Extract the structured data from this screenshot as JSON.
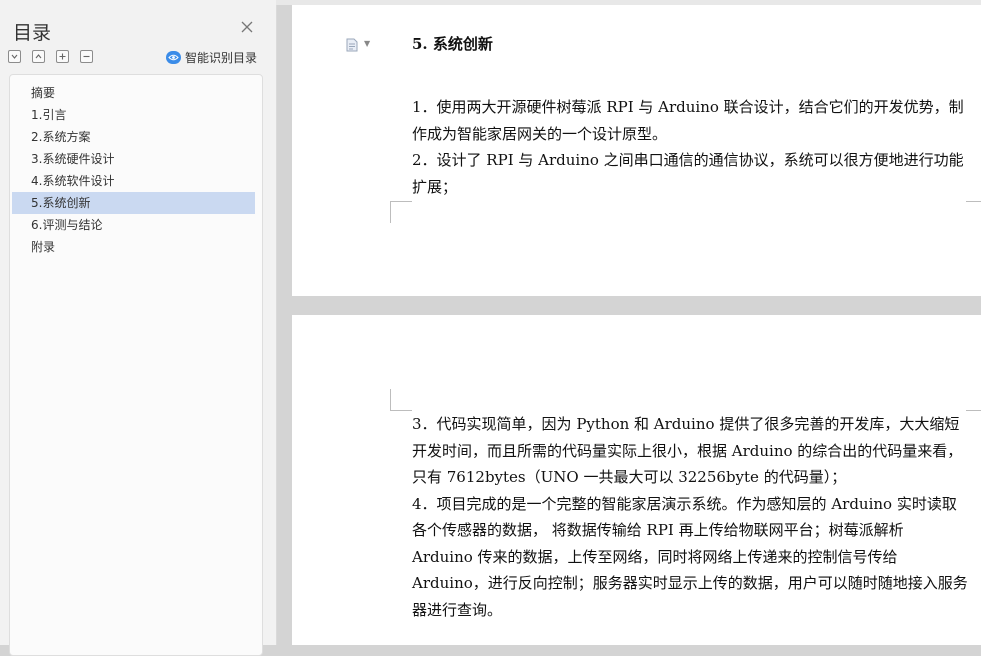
{
  "toc": {
    "title": "目录",
    "close_icon": "close-icon",
    "tools": [
      "collapse-all-icon",
      "expand-up-icon",
      "add-level-icon",
      "remove-level-icon"
    ],
    "smart_label": "智能识别目录",
    "smart_icon": "smart-recognize-icon",
    "items": [
      {
        "label": "摘要",
        "active": false
      },
      {
        "label": "1.引言",
        "active": false
      },
      {
        "label": "2.系统方案",
        "active": false
      },
      {
        "label": "3.系统硬件设计",
        "active": false
      },
      {
        "label": "4.系统软件设计",
        "active": false
      },
      {
        "label": "5.系统创新",
        "active": true
      },
      {
        "label": "6.评测与结论",
        "active": false
      },
      {
        "label": "附录",
        "active": false
      }
    ],
    "active_color": "#cad9f1"
  },
  "document": {
    "heading": "5.   系统创新",
    "page1_paragraphs": [
      "1．使用两大开源硬件树莓派 RPI 与 Arduino 联合设计，结合它们的开发优势，制作成为智能家居网关的一个设计原型。",
      "2．设计了 RPI 与 Arduino 之间串口通信的通信协议，系统可以很方便地进行功能扩展；"
    ],
    "page2_paragraphs": [
      "3．代码实现简单，因为 Python 和 Arduino 提供了很多完善的开发库，大大缩短开发时间，而且所需的代码量实际上很小，根据 Arduino 的综合出的代码量来看，只有 7612bytes（UNO 一共最大可以 32256byte 的代码量）；",
      "4．项目完成的是一个完整的智能家居演示系统。作为感知层的 Arduino 实时读取各个传感器的数据，  将数据传输给 RPI 再上传给物联网平台；树莓派解析 Arduino 传来的数据，上传至网络，同时将网络上传递来的控制信号传给 Arduino，进行反向控制；服务器实时显示上传的数据，用户可以随时随地接入服务器进行查询。"
    ]
  }
}
